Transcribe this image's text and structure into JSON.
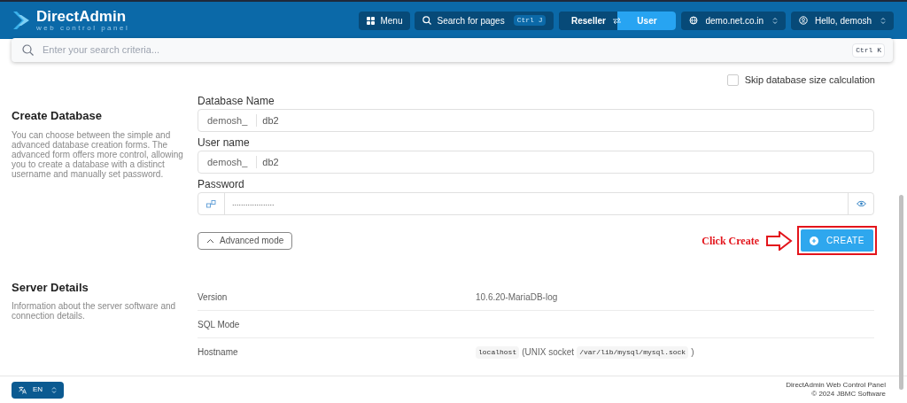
{
  "header": {
    "logo": {
      "title": "DirectAdmin",
      "subtitle": "web control panel"
    },
    "menu_button": "Menu",
    "page_search": {
      "label": "Search for pages",
      "shortcut": "Ctrl J"
    },
    "role_switch": [
      {
        "label": "Reseller",
        "selected": false
      },
      {
        "label": "User",
        "selected": true
      }
    ],
    "domain_select": "demo.net.co.in",
    "user_menu": "Hello, demosh"
  },
  "search": {
    "placeholder": "Enter your search criteria...",
    "shortcut": "Ctrl K"
  },
  "skip_size": {
    "label": "Skip database size calculation",
    "checked": false
  },
  "create_database": {
    "title": "Create Database",
    "description": "You can choose between the simple and advanced database creation forms. The advanced form offers more control, allowing you to create a database with a distinct username and manually set password.",
    "fields": [
      {
        "kind": "prefixed",
        "label": "Database Name",
        "prefix": "demosh_",
        "value": "db2"
      },
      {
        "kind": "prefixed",
        "label": "User name",
        "prefix": "demosh_",
        "value": "db2"
      },
      {
        "kind": "password",
        "label": "Password",
        "value": "..................."
      }
    ],
    "advanced_button": "Advanced mode",
    "create_button": "CREATE",
    "annotation": "Click Create"
  },
  "server_details": {
    "title": "Server Details",
    "description": "Information about the server software and connection details.",
    "rows": [
      {
        "label": "Version",
        "parts": [
          {
            "kind": "text",
            "text": "10.6.20-MariaDB-log"
          }
        ]
      },
      {
        "label": "SQL Mode"
      },
      {
        "label": "Hostname",
        "parts": [
          {
            "kind": "code",
            "text": "localhost"
          },
          {
            "kind": "text",
            "text": "(UNIX socket"
          },
          {
            "kind": "code",
            "text": "/var/lib/mysql/mysql.sock"
          },
          {
            "kind": "text",
            "text": ")"
          }
        ]
      }
    ]
  },
  "footer": {
    "language": "EN",
    "credits": [
      "DirectAdmin Web Control Panel",
      "© 2024 JBMC Software"
    ]
  }
}
